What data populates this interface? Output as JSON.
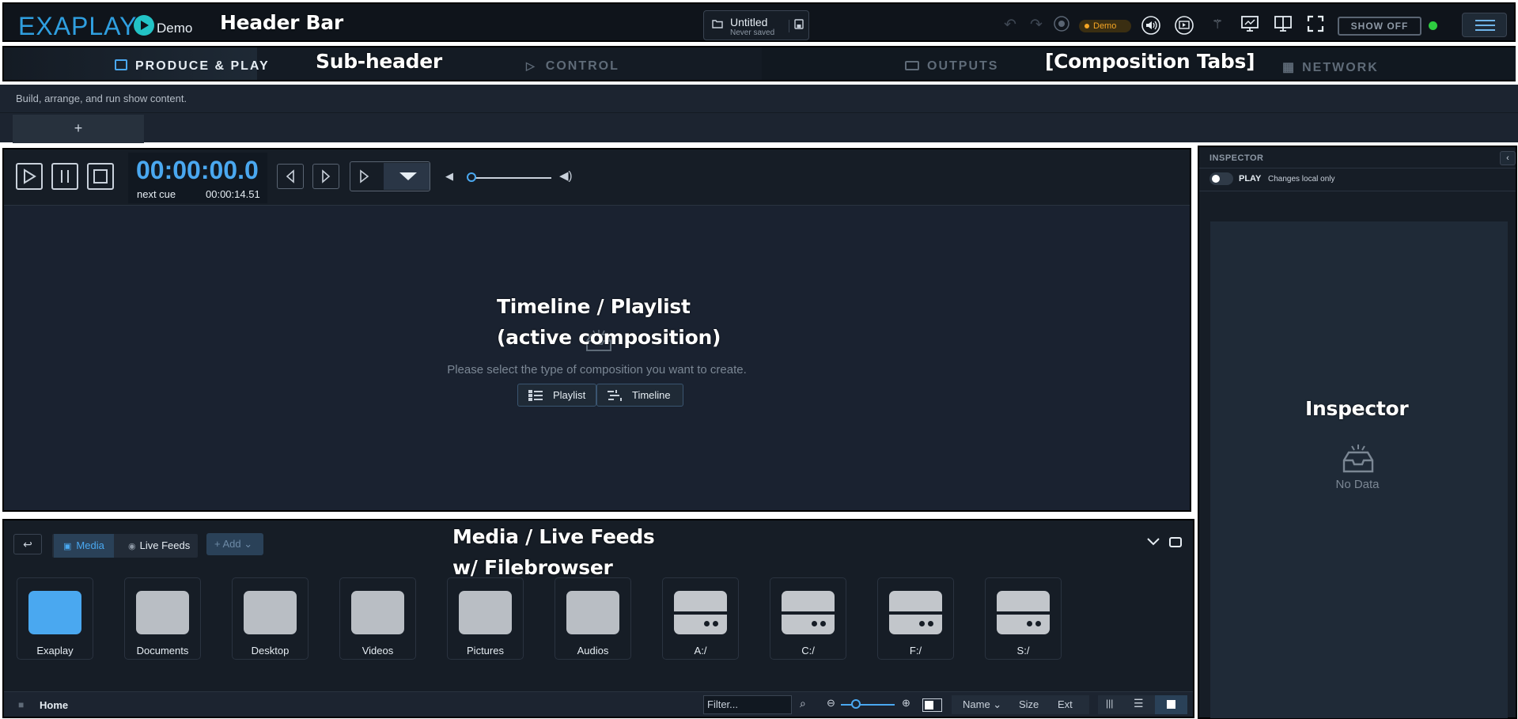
{
  "header": {
    "logo_text": "EXAPLAY",
    "logo_suffix": "Demo",
    "file_title": "Untitled",
    "file_status": "Never saved",
    "demo_badge": "Demo",
    "show_off_label": "SHOW OFF",
    "icons": [
      "folder-icon",
      "save-icon",
      "undo-icon",
      "redo-icon",
      "record-icon",
      "audio-icon",
      "video-icon",
      "signal-icon",
      "monitor-icon",
      "split-screen-icon",
      "fullscreen-icon",
      "menu-icon"
    ],
    "status_color": "#2ecc40"
  },
  "subheader": {
    "tabs": [
      {
        "label": "PRODUCE & PLAY",
        "active": true
      },
      {
        "label": "CONTROL",
        "active": false
      },
      {
        "label": "OUTPUTS",
        "active": false
      },
      {
        "label": "NETWORK",
        "active": false
      }
    ],
    "description": "Build, arrange, and run show content.",
    "add_tab_label": "+"
  },
  "transport": {
    "timecode": "00:00:00.0",
    "next_cue_label": "next cue",
    "next_cue_time": "00:00:14.51",
    "volume_level": 0.0
  },
  "composition": {
    "empty_message": "Please select the type of composition you want to create.",
    "playlist_label": "Playlist",
    "timeline_label": "Timeline"
  },
  "media": {
    "tabs": [
      {
        "label": "Media",
        "active": true
      },
      {
        "label": "Live Feeds",
        "active": false
      }
    ],
    "add_label": "Add",
    "folders": [
      "Exaplay",
      "Documents",
      "Desktop",
      "Videos",
      "Pictures",
      "Audios",
      "A:/",
      "C:/",
      "F:/",
      "S:/"
    ],
    "status": {
      "location": "Home",
      "filter_placeholder": "Filter...",
      "sort_name": "Name",
      "sort_size": "Size",
      "sort_ext": "Ext"
    }
  },
  "inspector": {
    "title": "INSPECTOR",
    "play_label": "PLAY",
    "play_note": "Changes local only",
    "no_data": "No Data"
  },
  "annotations": {
    "header_bar": "Header Bar",
    "sub_header": "Sub-header",
    "composition_tabs": "[Composition Tabs]",
    "timeline_line1": "Timeline / Playlist",
    "timeline_line2": "(active composition)",
    "inspector": "Inspector",
    "media_line1": "Media / Live Feeds",
    "media_line2": "w/ Filebrowser"
  },
  "colors": {
    "accent": "#4aa8f0",
    "demo": "#f5a524",
    "background": "#1a2230"
  }
}
